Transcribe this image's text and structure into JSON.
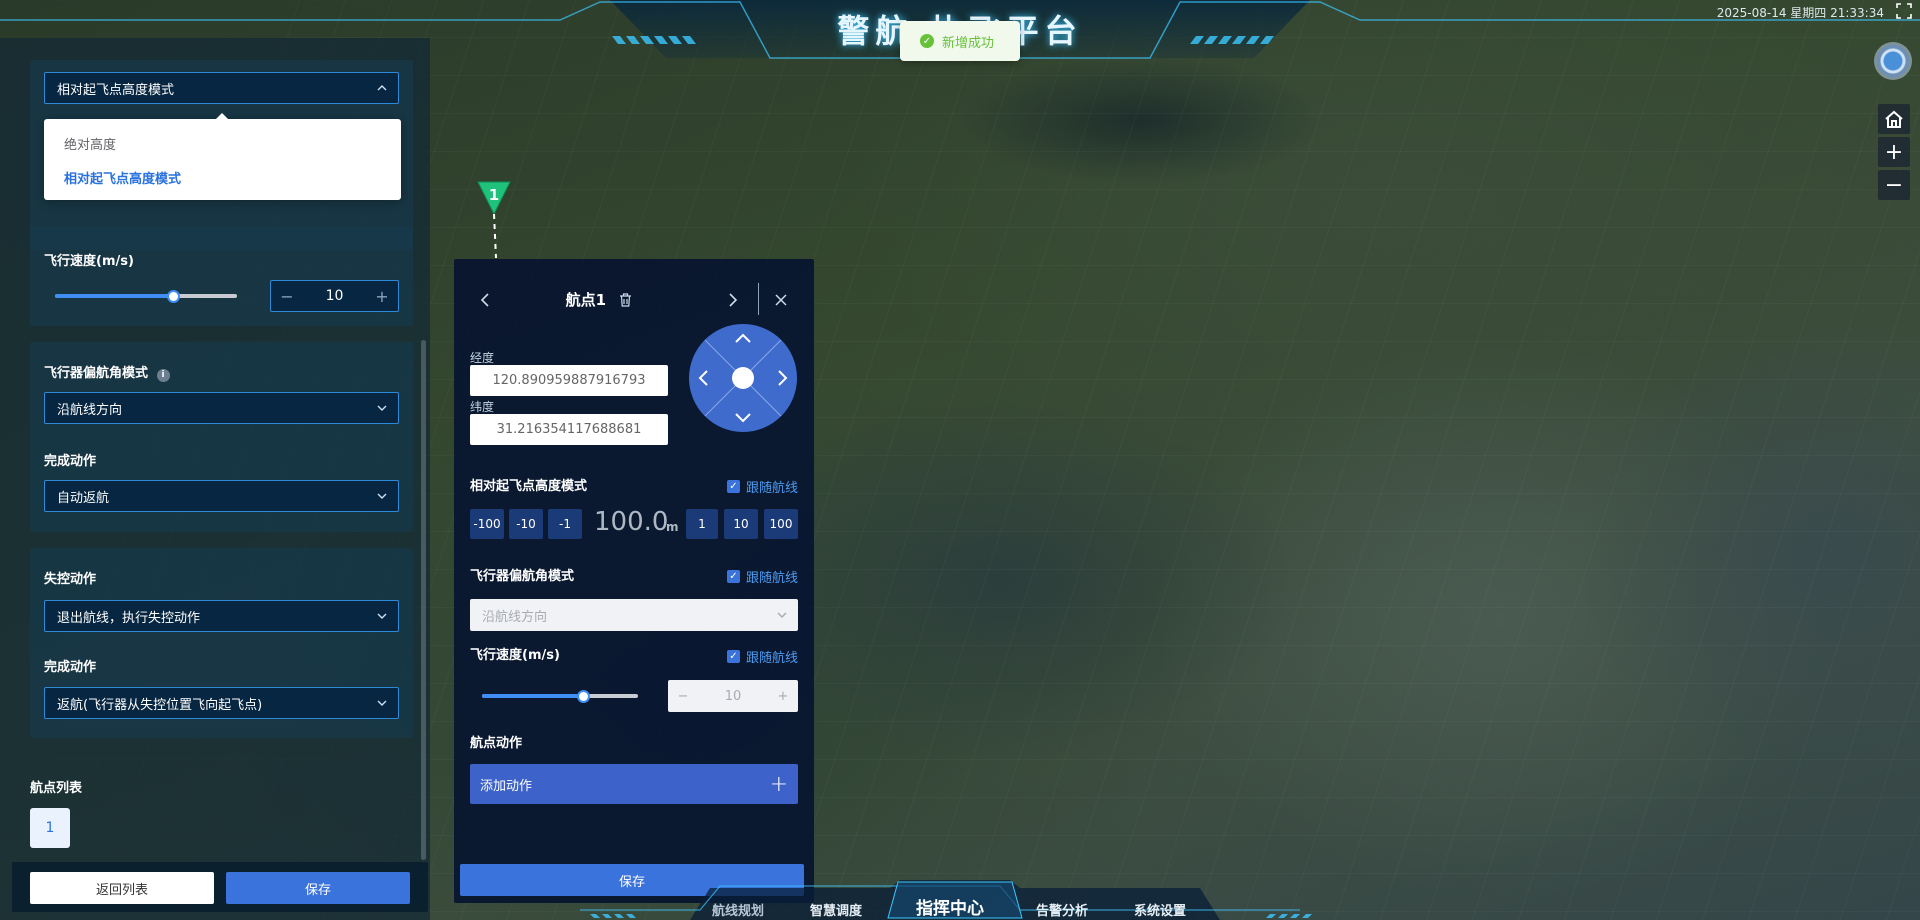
{
  "header": {
    "title": "警航   执飞平台",
    "datetime": "2025-08-14  星期四  21:33:34"
  },
  "toast": {
    "message": "新增成功"
  },
  "left_panel": {
    "altitude_mode_select": "相对起飞点高度模式",
    "altitude_mode_options": [
      "绝对高度",
      "相对起飞点高度模式"
    ],
    "speed_label": "飞行速度(m/s)",
    "speed_value": "10",
    "speed_slider_fraction": 0.65,
    "yaw_mode_label": "飞行器偏航角模式",
    "yaw_mode_value": "沿航线方向",
    "finish_action_label": "完成动作",
    "finish_action_value": "自动返航",
    "lost_control_label": "失控动作",
    "lost_control_value": "退出航线，执行失控动作",
    "finish_action2_label": "完成动作",
    "finish_action2_value": "返航(飞行器从失控位置飞向起飞点)",
    "waypoint_list_label": "航点列表",
    "waypoint_chip": "1",
    "back_button": "返回列表",
    "save_button": "保存"
  },
  "marker": {
    "label": "1"
  },
  "waypoint_panel": {
    "title": "航点1",
    "lng_label": "经度",
    "lng_value": "120.890959887916793",
    "lat_label": "纬度",
    "lat_value": "31.216354117688681",
    "alt_mode_label": "相对起飞点高度模式",
    "follow_label": "跟随航线",
    "alt_buttons": [
      "-100",
      "-10",
      "-1",
      "1",
      "10",
      "100"
    ],
    "alt_value": "100.0",
    "alt_unit": "m",
    "yaw_label": "飞行器偏航角模式",
    "yaw_value": "沿航线方向",
    "speed_label": "飞行速度(m/s)",
    "speed_value": "10",
    "speed_slider_fraction": 0.65,
    "action_label": "航点动作",
    "add_action": "添加动作",
    "save_button": "保存"
  },
  "bottom_nav": {
    "tabs": [
      "航线规划",
      "智慧调度",
      "指挥中心",
      "告警分析",
      "系统设置"
    ],
    "active": "指挥中心"
  },
  "colors": {
    "accent": "#3b73dc",
    "success": "#67c23a",
    "cyan_glow": "#3cc8ff"
  }
}
